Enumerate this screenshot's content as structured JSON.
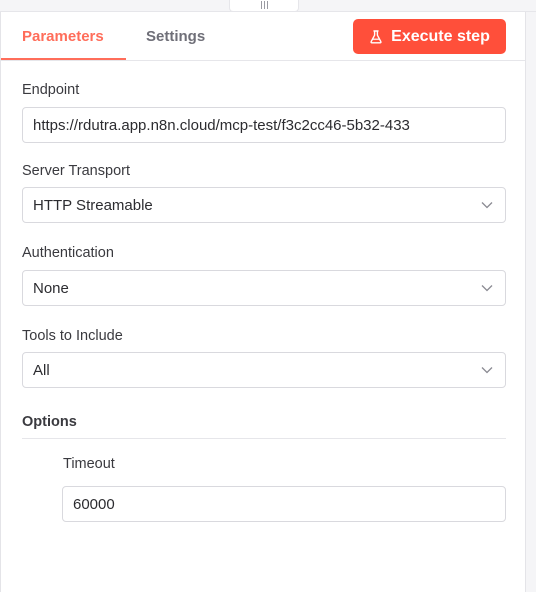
{
  "tabs": {
    "parameters": "Parameters",
    "settings": "Settings"
  },
  "execute_button": {
    "label": "Execute step",
    "icon": "flask-icon"
  },
  "fields": {
    "endpoint": {
      "label": "Endpoint",
      "value": "https://rdutra.app.n8n.cloud/mcp-test/f3c2cc46-5b32-433"
    },
    "server_transport": {
      "label": "Server Transport",
      "value": "HTTP Streamable"
    },
    "authentication": {
      "label": "Authentication",
      "value": "None"
    },
    "tools_to_include": {
      "label": "Tools to Include",
      "value": "All"
    }
  },
  "options": {
    "title": "Options",
    "timeout": {
      "label": "Timeout",
      "value": "60000"
    }
  },
  "colors": {
    "accent": "#ff6d5a",
    "button": "#ff4f3a"
  }
}
